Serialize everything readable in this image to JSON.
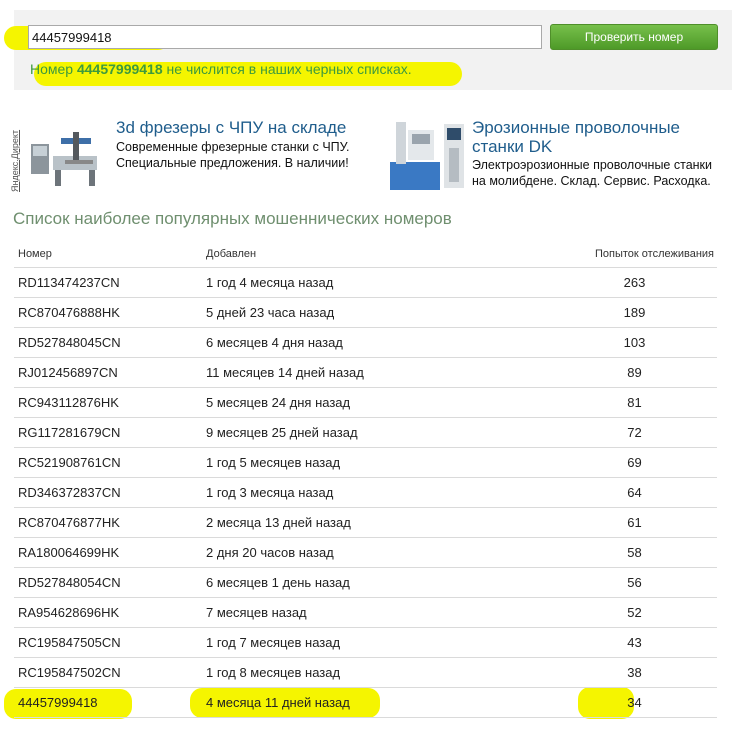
{
  "check": {
    "input_value": "44457999418",
    "button_label": "Проверить номер",
    "result_prefix": "Номер",
    "result_number": "44457999418",
    "result_suffix": "не числится в наших черных списках."
  },
  "ads": {
    "vertical_label": "Яндекс.Директ",
    "items": [
      {
        "title": "3d фрезеры с ЧПУ на складе",
        "text_line1": "Современные фрезерные станки с ЧПУ.",
        "text_line2": "Специальные предложения. В наличии!"
      },
      {
        "title_line1": "Эрозионные проволочные",
        "title_line2": "станки DK",
        "text_line1": "Электроэрозионные проволочные станки",
        "text_line2": "на молибдене. Склад. Сервис. Расходка."
      }
    ]
  },
  "list": {
    "heading": "Список наиболее популярных мошеннических номеров",
    "columns": [
      "Номер",
      "Добавлен",
      "Попыток отслеживания"
    ],
    "rows": [
      [
        "RD113474237CN",
        "1 год 4 месяца назад",
        "263"
      ],
      [
        "RC870476888HK",
        "5 дней 23 часа назад",
        "189"
      ],
      [
        "RD527848045CN",
        "6 месяцев 4 дня назад",
        "103"
      ],
      [
        "RJ012456897CN",
        "11 месяцев 14 дней назад",
        "89"
      ],
      [
        "RC943112876HK",
        "5 месяцев 24 дня назад",
        "81"
      ],
      [
        "RG117281679CN",
        "9 месяцев 25 дней назад",
        "72"
      ],
      [
        "RC521908761CN",
        "1 год 5 месяцев назад",
        "69"
      ],
      [
        "RD346372837CN",
        "1 год 3 месяца назад",
        "64"
      ],
      [
        "RC870476877HK",
        "2 месяца 13 дней назад",
        "61"
      ],
      [
        "RA180064699HK",
        "2 дня 20 часов назад",
        "58"
      ],
      [
        "RD527848054CN",
        "6 месяцев 1 день назад",
        "56"
      ],
      [
        "RA954628696HK",
        "7 месяцев назад",
        "52"
      ],
      [
        "RC195847505CN",
        "1 год 7 месяцев назад",
        "43"
      ],
      [
        "RC195847502CN",
        "1 год 8 месяцев назад",
        "38"
      ],
      [
        "44457999418",
        "4 месяца 11 дней назад",
        "34"
      ]
    ]
  },
  "colors": {
    "highlight": "#f5f500",
    "button": "#5aa832",
    "result_text": "#3d9a3d",
    "ad_title": "#1f5d8c"
  }
}
